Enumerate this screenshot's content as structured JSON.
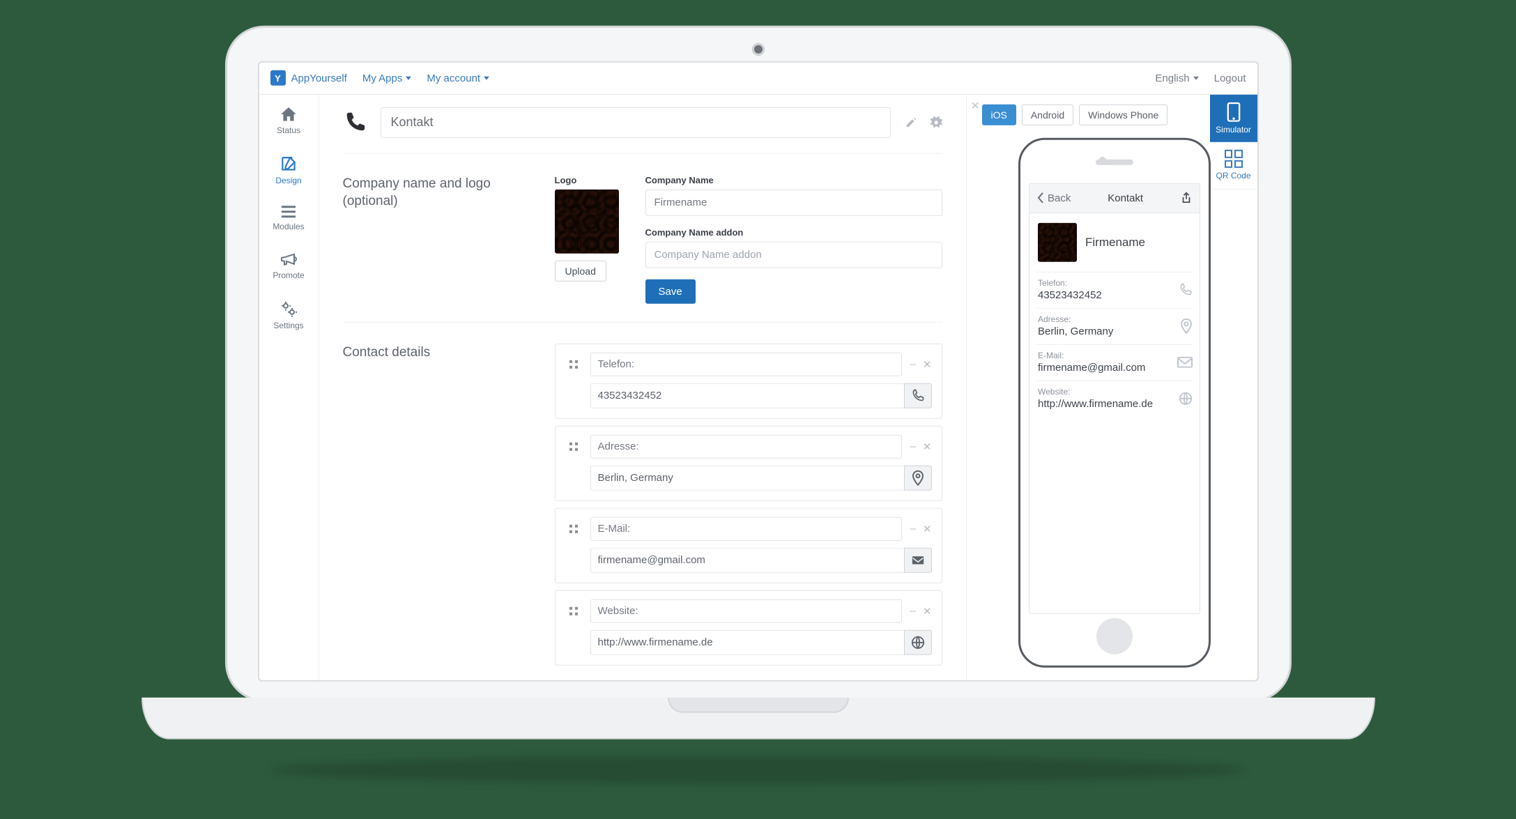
{
  "brand": "AppYourself",
  "nav": {
    "my_apps": "My Apps",
    "my_account": "My account",
    "language": "English",
    "logout": "Logout"
  },
  "sidebar": {
    "status": "Status",
    "design": "Design",
    "modules": "Modules",
    "promote": "Promote",
    "settings": "Settings"
  },
  "module": {
    "title": "Kontakt"
  },
  "section_company": {
    "heading": "Company name and logo (optional)",
    "logo_label": "Logo",
    "upload": "Upload",
    "name_label": "Company Name",
    "name_value": "Firmename",
    "addon_label": "Company Name addon",
    "addon_placeholder": "Company Name addon",
    "save": "Save"
  },
  "section_contact": {
    "heading": "Contact details",
    "items": [
      {
        "label": "Telefon:",
        "value": "43523432452",
        "icon": "phone"
      },
      {
        "label": "Adresse:",
        "value": "Berlin, Germany",
        "icon": "pin"
      },
      {
        "label": "E-Mail:",
        "value": "firmename@gmail.com",
        "icon": "mail"
      },
      {
        "label": "Website:",
        "value": "http://www.firmename.de",
        "icon": "globe"
      }
    ]
  },
  "preview": {
    "tabs": {
      "ios": "iOS",
      "android": "Android",
      "wp": "Windows Phone"
    },
    "simulator": "Simulator",
    "qrcode": "QR Code",
    "back": "Back",
    "title": "Kontakt",
    "company": "Firmename",
    "items": [
      {
        "label": "Telefon:",
        "value": "43523432452",
        "icon": "phone"
      },
      {
        "label": "Adresse:",
        "value": "Berlin, Germany",
        "icon": "pin"
      },
      {
        "label": "E-Mail:",
        "value": "firmename@gmail.com",
        "icon": "mail"
      },
      {
        "label": "Website:",
        "value": "http://www.firmename.de",
        "icon": "globe"
      }
    ]
  }
}
